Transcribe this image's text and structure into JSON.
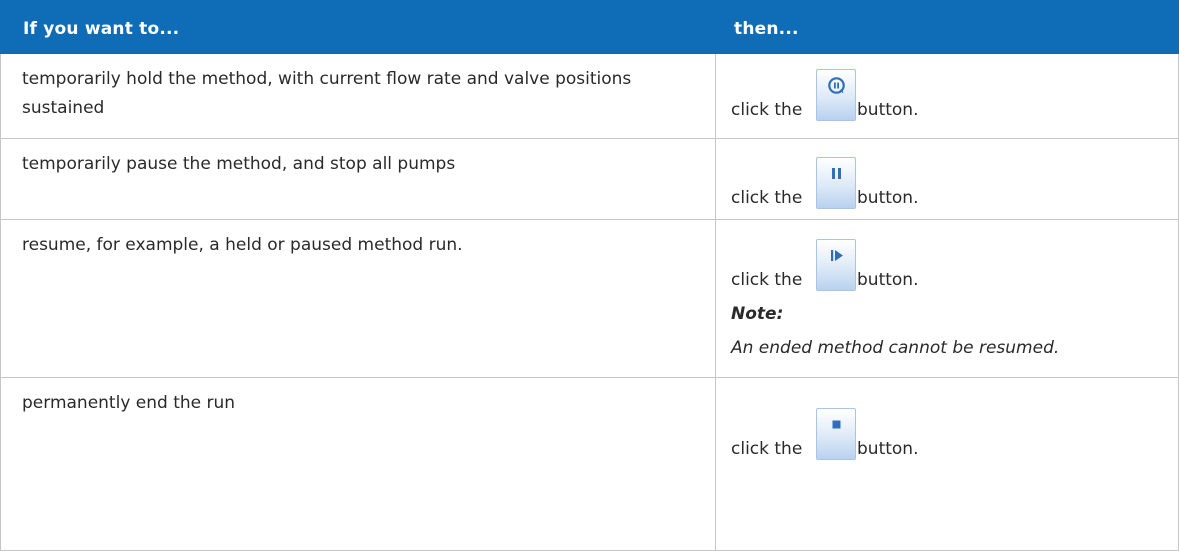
{
  "table": {
    "header": {
      "col1": "If you want to...",
      "col2": "then..."
    },
    "rows": [
      {
        "condition": "temporarily hold the method, with current flow rate and valve positions sustained",
        "action_prefix": "click the",
        "button_icon": "hold-icon",
        "action_suffix": "button."
      },
      {
        "condition": "temporarily pause the method, and stop all pumps",
        "action_prefix": "click the",
        "button_icon": "pause-icon",
        "action_suffix": "button."
      },
      {
        "condition": "resume, for example, a held or paused method run.",
        "action_prefix": "click the",
        "button_icon": "resume-icon",
        "action_suffix": "button.",
        "note_label": "Note:",
        "note_text": "An ended method cannot be resumed."
      },
      {
        "condition": "permanently end the run",
        "action_prefix": "click the",
        "button_icon": "end-icon",
        "action_suffix": "button."
      }
    ]
  },
  "colors": {
    "header_bg": "#0f6cb6",
    "header_text": "#ffffff",
    "border": "#c6c6c6",
    "icon_blue": "#2f6fb8"
  }
}
